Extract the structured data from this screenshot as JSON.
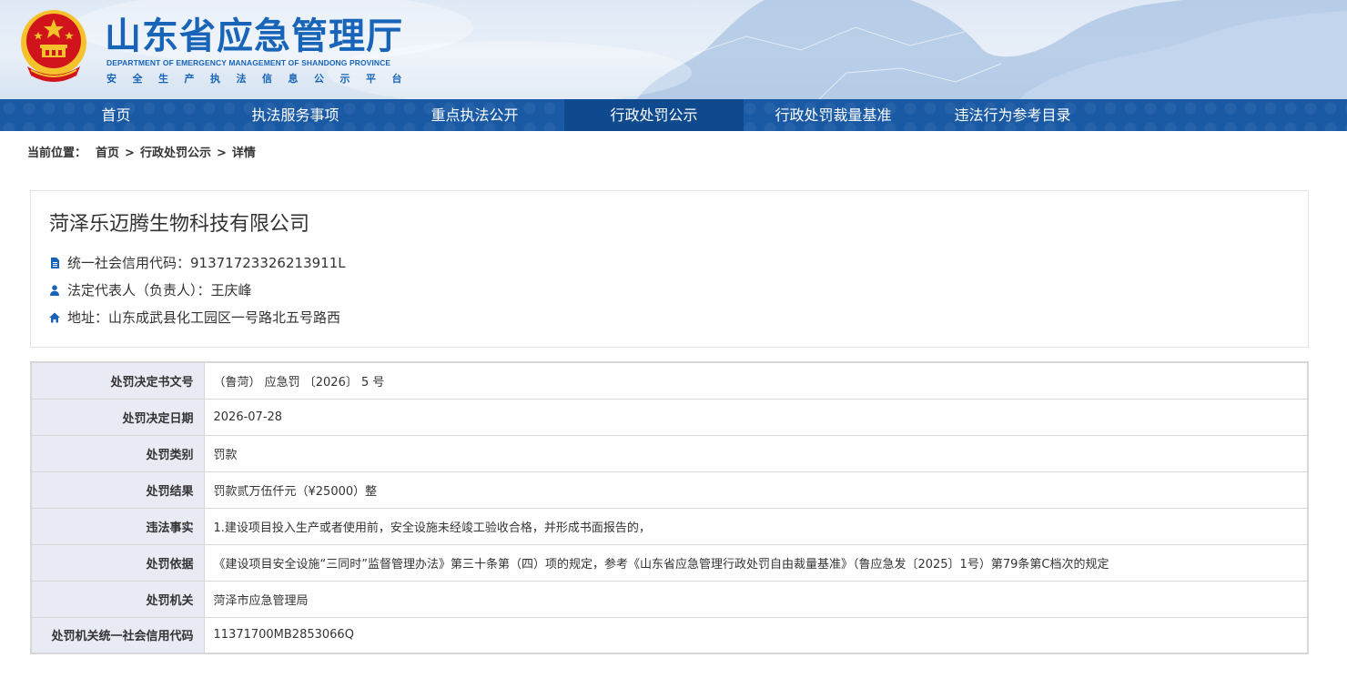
{
  "header": {
    "title": "山东省应急管理厅",
    "title_en": "DEPARTMENT OF EMERGENCY MANAGEMENT OF SHANDONG PROVINCE",
    "subtitle": "安全生产执法信息公示平台"
  },
  "nav": {
    "items": [
      {
        "label": "首页"
      },
      {
        "label": "执法服务事项"
      },
      {
        "label": "重点执法公开"
      },
      {
        "label": "行政处罚公示"
      },
      {
        "label": "行政处罚裁量基准"
      },
      {
        "label": "违法行为参考目录"
      }
    ],
    "active_index": 3
  },
  "breadcrumb": {
    "lead": "当前位置：",
    "items": [
      "首页",
      "行政处罚公示",
      "详情"
    ],
    "separator": ">"
  },
  "company": {
    "name": "菏泽乐迈腾生物科技有限公司",
    "credit_code": "统一社会信用代码：91371723326213911L",
    "legal_rep": "法定代表人（负责人）：王庆峰",
    "address": "地址：山东成武县化工园区一号路北五号路西"
  },
  "details": [
    {
      "label": "处罚决定书文号",
      "value": "（鲁菏） 应急罚 〔2026〕 5 号"
    },
    {
      "label": "处罚决定日期",
      "value": "2026-07-28"
    },
    {
      "label": "处罚类别",
      "value": "罚款"
    },
    {
      "label": "处罚结果",
      "value": "罚款贰万伍仟元（¥25000）整"
    },
    {
      "label": "违法事实",
      "value": "1.建设项目投入生产或者使用前，安全设施未经竣工验收合格，并形成书面报告的，"
    },
    {
      "label": "处罚依据",
      "value": "《建设项目安全设施“三同时”监督管理办法》第三十条第（四）项的规定，参考《山东省应急管理行政处罚自由裁量基准》（鲁应急发〔2025〕1号）第79条第C档次的规定"
    },
    {
      "label": "处罚机关",
      "value": "菏泽市应急管理局"
    },
    {
      "label": "处罚机关统一社会信用代码",
      "value": "11371700MB2853066Q"
    }
  ],
  "colors": {
    "brand_blue": "#1764b8",
    "nav_bg": "#1a5aa4",
    "nav_active": "#104a8e",
    "label_bg": "#e8eaf4",
    "emblem_red": "#d1141b",
    "emblem_gold": "#f5c22b"
  },
  "icons": {
    "emblem": "national-emblem",
    "credit": "document-icon",
    "legal": "person-icon",
    "address": "home-icon"
  }
}
